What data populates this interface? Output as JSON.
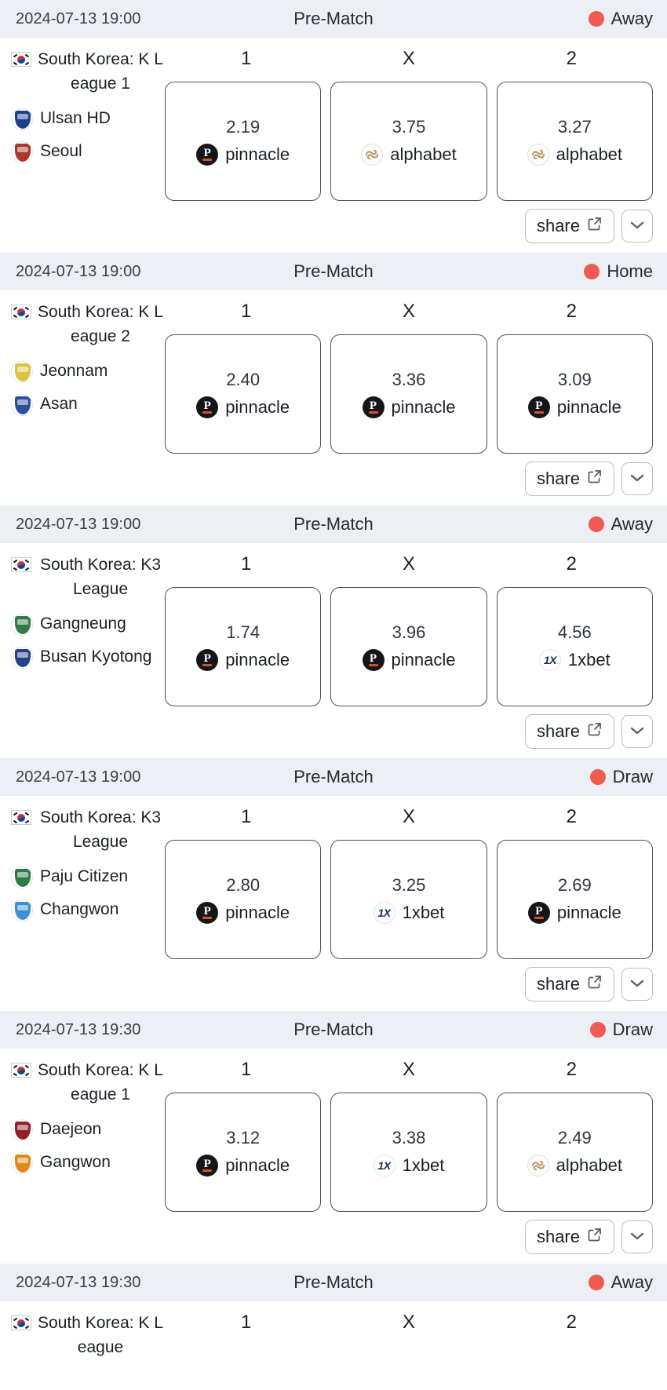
{
  "colors": {
    "status_dot": "#f05a52",
    "header_bg": "#eceff3",
    "odds_border": "#4a5160",
    "pinnacle": "#15151c",
    "alphabet": "#b79a6d",
    "onexbet": "#10305e"
  },
  "labels": {
    "col1": "1",
    "colX": "X",
    "col2": "2",
    "share": "share",
    "share_icon": "external-link-icon",
    "expand_icon": "chevron-down-icon",
    "status_dot_icon": "status-dot-icon",
    "flag_icon": "south-korea-flag-icon"
  },
  "matches": [
    {
      "time": "2024-07-13 19:00",
      "state": "Pre-Match",
      "status": "Away",
      "league": "South Korea: K League 1",
      "home_team": "Ulsan HD",
      "away_team": "Seoul",
      "home_crest": "#1d3f8f",
      "away_crest": "#a6382c",
      "odds": [
        {
          "value": "2.19",
          "bookmaker": "pinnacle",
          "logo": "pinnacle"
        },
        {
          "value": "3.75",
          "bookmaker": "alphabet",
          "logo": "alphabet"
        },
        {
          "value": "3.27",
          "bookmaker": "alphabet",
          "logo": "alphabet"
        }
      ]
    },
    {
      "time": "2024-07-13 19:00",
      "state": "Pre-Match",
      "status": "Home",
      "league": "South Korea: K League 2",
      "home_team": "Jeonnam",
      "away_team": "Asan",
      "home_crest": "#d8c441",
      "away_crest": "#2a4f9c",
      "odds": [
        {
          "value": "2.40",
          "bookmaker": "pinnacle",
          "logo": "pinnacle"
        },
        {
          "value": "3.36",
          "bookmaker": "pinnacle",
          "logo": "pinnacle"
        },
        {
          "value": "3.09",
          "bookmaker": "pinnacle",
          "logo": "pinnacle"
        }
      ]
    },
    {
      "time": "2024-07-13 19:00",
      "state": "Pre-Match",
      "status": "Away",
      "league": "South Korea: K3 League",
      "home_team": "Gangneung",
      "away_team": "Busan Kyotong",
      "home_crest": "#2f7a46",
      "away_crest": "#27408a",
      "odds": [
        {
          "value": "1.74",
          "bookmaker": "pinnacle",
          "logo": "pinnacle"
        },
        {
          "value": "3.96",
          "bookmaker": "pinnacle",
          "logo": "pinnacle"
        },
        {
          "value": "4.56",
          "bookmaker": "1xbet",
          "logo": "onexbet"
        }
      ]
    },
    {
      "time": "2024-07-13 19:00",
      "state": "Pre-Match",
      "status": "Draw",
      "league": "South Korea: K3 League",
      "home_team": "Paju Citizen",
      "away_team": "Changwon",
      "home_crest": "#2f7a46",
      "away_crest": "#3d8fd1",
      "odds": [
        {
          "value": "2.80",
          "bookmaker": "pinnacle",
          "logo": "pinnacle"
        },
        {
          "value": "3.25",
          "bookmaker": "1xbet",
          "logo": "onexbet"
        },
        {
          "value": "2.69",
          "bookmaker": "pinnacle",
          "logo": "pinnacle"
        }
      ]
    },
    {
      "time": "2024-07-13 19:30",
      "state": "Pre-Match",
      "status": "Draw",
      "league": "South Korea: K League 1",
      "home_team": "Daejeon",
      "away_team": "Gangwon",
      "home_crest": "#8e1f2b",
      "away_crest": "#e08a1e",
      "odds": [
        {
          "value": "3.12",
          "bookmaker": "pinnacle",
          "logo": "pinnacle"
        },
        {
          "value": "3.38",
          "bookmaker": "1xbet",
          "logo": "onexbet"
        },
        {
          "value": "2.49",
          "bookmaker": "alphabet",
          "logo": "alphabet"
        }
      ]
    },
    {
      "time": "2024-07-13 19:30",
      "state": "Pre-Match",
      "status": "Away",
      "league": "South Korea: K League",
      "home_team": "",
      "away_team": "",
      "home_crest": "#6b7280",
      "away_crest": "#6b7280",
      "odds": [],
      "partial": true
    }
  ]
}
